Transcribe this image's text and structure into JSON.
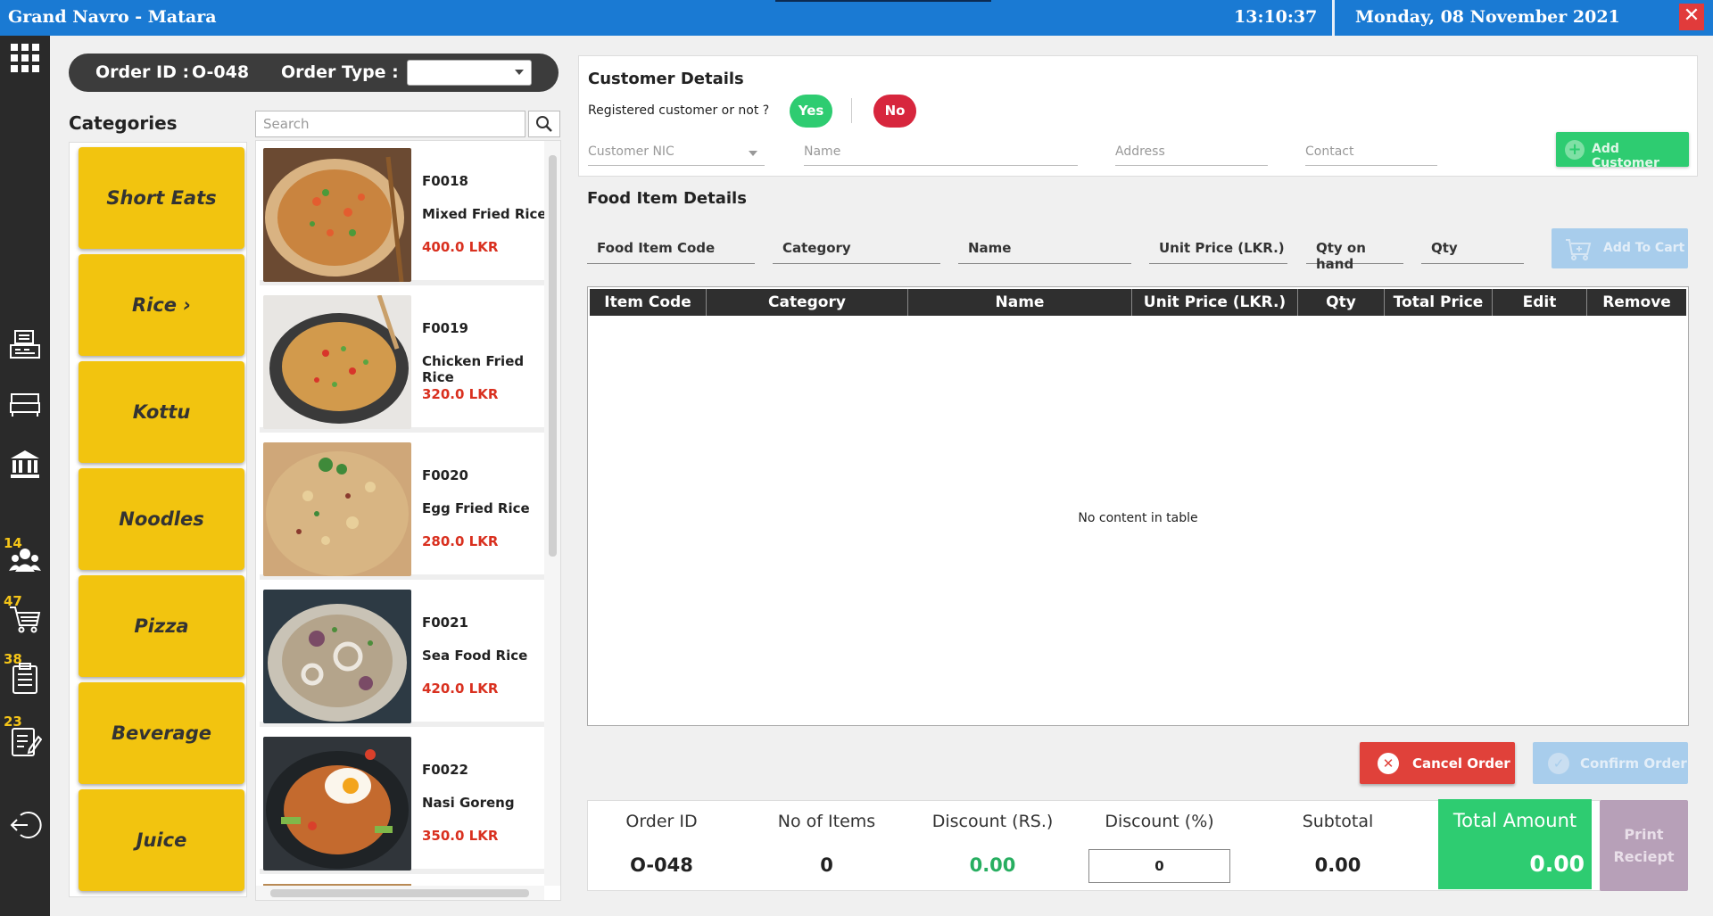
{
  "header": {
    "title": "Grand Navro - Matara",
    "time": "13:10:37",
    "date": "Monday, 08 November 2021"
  },
  "sidebar": {
    "badges": {
      "customers": "14",
      "orders": "47",
      "reports": "38",
      "notes": "23"
    }
  },
  "order": {
    "id_label": "Order ID :",
    "id_value": "O-048",
    "type_label": "Order Type :"
  },
  "categories": {
    "title": "Categories",
    "items": [
      "Short Eats",
      "Rice ›",
      "Kottu",
      "Noodles",
      "Pizza",
      "Beverage",
      "Juice"
    ]
  },
  "search": {
    "placeholder": "Search"
  },
  "foods": [
    {
      "code": "F0018",
      "name": "Mixed Fried Rice",
      "price": "400.0 LKR"
    },
    {
      "code": "F0019",
      "name": "Chicken Fried Rice",
      "price": "320.0 LKR"
    },
    {
      "code": "F0020",
      "name": "Egg Fried Rice",
      "price": "280.0 LKR"
    },
    {
      "code": "F0021",
      "name": "Sea Food Rice",
      "price": "420.0 LKR"
    },
    {
      "code": "F0022",
      "name": "Nasi Goreng",
      "price": "350.0 LKR"
    }
  ],
  "customer": {
    "title": "Customer Details",
    "registered_question": "Registered customer or not ?",
    "yes": "Yes",
    "no": "No",
    "nic_placeholder": "Customer NIC",
    "name_placeholder": "Name",
    "address_placeholder": "Address",
    "contact_placeholder": "Contact",
    "add_button": "Add Customer"
  },
  "food_details": {
    "title": "Food Item Details",
    "fields": [
      "Food Item Code",
      "Category",
      "Name",
      "Unit Price (LKR.)",
      "Qty on hand",
      "Qty"
    ],
    "add_to_cart": "Add To Cart"
  },
  "table": {
    "columns": [
      "Item Code",
      "Category",
      "Name",
      "Unit Price (LKR.)",
      "Qty",
      "Total Price",
      "Edit",
      "Remove"
    ],
    "empty_text": "No content in table"
  },
  "actions": {
    "cancel": "Cancel Order",
    "confirm": "Confirm Order"
  },
  "summary": {
    "order_id_label": "Order ID",
    "order_id_value": "O-048",
    "items_label": "No of Items",
    "items_value": "0",
    "discount_rs_label": "Discount (RS.)",
    "discount_rs_value": "0.00",
    "discount_pct_label": "Discount (%)",
    "discount_pct_value": "0",
    "subtotal_label": "Subtotal",
    "subtotal_value": "0.00",
    "total_label": "Total Amount",
    "total_value": "0.00",
    "print_label": "Print Reciept"
  },
  "colors": {
    "topbar": "#1a7ad3",
    "category_button": "#f2c40f",
    "green": "#2ecc71",
    "red": "#d7263d",
    "price_red": "#d9301f"
  }
}
